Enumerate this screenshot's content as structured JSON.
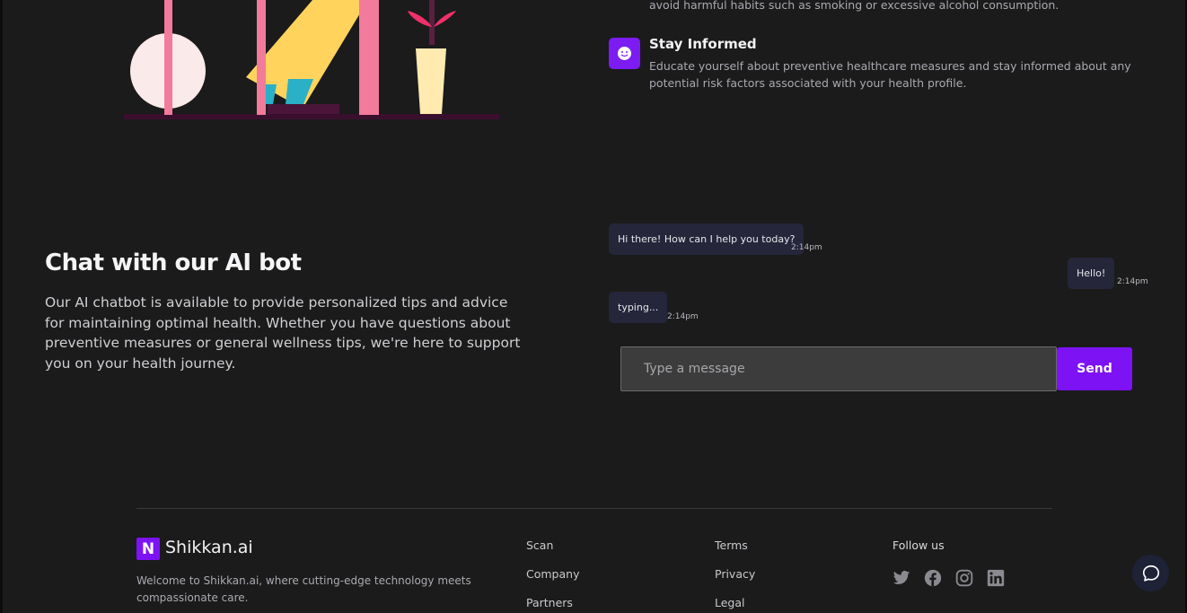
{
  "tips": {
    "fragment_text": "avoid harmful habits such as smoking or excessive alcohol consumption.",
    "item": {
      "title": "Stay Informed",
      "description": "Educate yourself about preventive healthcare measures and stay informed about any potential risk factors associated with your health profile.",
      "icon": "smiley-icon"
    }
  },
  "chat_section": {
    "heading": "Chat with our AI bot",
    "description": "Our AI chatbot is available to provide personalized tips and advice for maintaining optimal health. Whether you have questions about preventive measures or general wellness tips, we're here to support you on your health journey."
  },
  "chat": {
    "messages": [
      {
        "sender": "bot",
        "text": "Hi there! How can I help you today?",
        "time": "2:14pm"
      },
      {
        "sender": "user",
        "text": "Hello!",
        "time": "2:14pm"
      },
      {
        "sender": "bot",
        "text": "typing...",
        "time": "2:14pm"
      }
    ],
    "input_placeholder": "Type a message",
    "send_label": "Send"
  },
  "footer": {
    "logo_letter": "N",
    "brand": "Shikkan.ai",
    "description": "Welcome to Shikkan.ai, where cutting-edge technology meets compassionate care.",
    "col1": [
      "Scan",
      "Company",
      "Partners"
    ],
    "col2": [
      "Terms",
      "Privacy",
      "Legal"
    ],
    "follow_label": "Follow us",
    "socials": [
      "twitter-icon",
      "facebook-icon",
      "instagram-icon",
      "linkedin-icon"
    ]
  },
  "colors": {
    "accent": "#7d12f5",
    "background": "#1b1b1b",
    "bubble": "#25263a"
  }
}
